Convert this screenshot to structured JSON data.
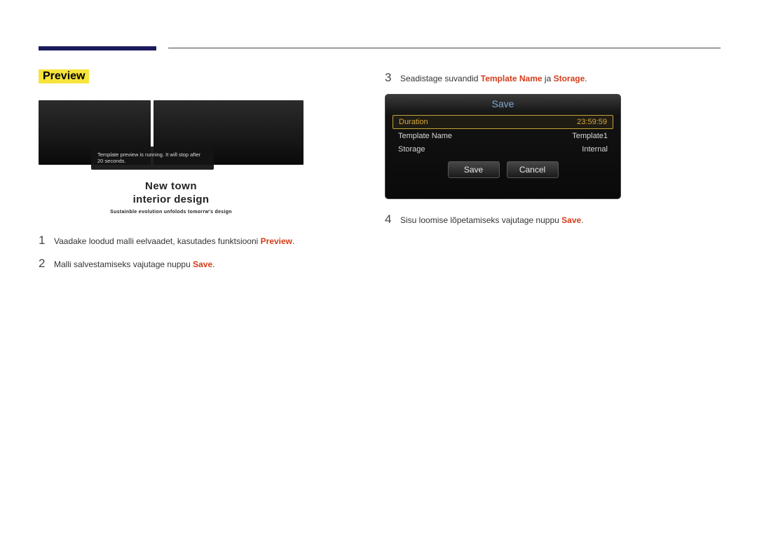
{
  "section_title": "Preview",
  "preview": {
    "toast": "Template preview is running. It will stop after 20 seconds.",
    "caption": {
      "line1": "New  town",
      "line2": "interior  design",
      "line3": "Sustainble evolution unfolods tomorrw's design"
    }
  },
  "steps": {
    "s1": {
      "num": "1",
      "pre": "Vaadake loodud malli eelvaadet, kasutades funktsiooni ",
      "kw": "Preview",
      "post": "."
    },
    "s2": {
      "num": "2",
      "pre": "Malli salvestamiseks vajutage nuppu ",
      "kw": "Save",
      "post": "."
    },
    "s3": {
      "num": "3",
      "pre": "Seadistage suvandid ",
      "kw1": "Template Name",
      "mid": " ja ",
      "kw2": "Storage",
      "post": "."
    },
    "s4": {
      "num": "4",
      "pre": "Sisu loomise lõpetamiseks vajutage nuppu ",
      "kw": "Save",
      "post": "."
    }
  },
  "dialog": {
    "title": "Save",
    "rows": {
      "duration": {
        "label": "Duration",
        "value": "23:59:59"
      },
      "tname": {
        "label": "Template Name",
        "value": "Template1"
      },
      "storage": {
        "label": "Storage",
        "value": "Internal"
      }
    },
    "buttons": {
      "save": "Save",
      "cancel": "Cancel"
    }
  }
}
